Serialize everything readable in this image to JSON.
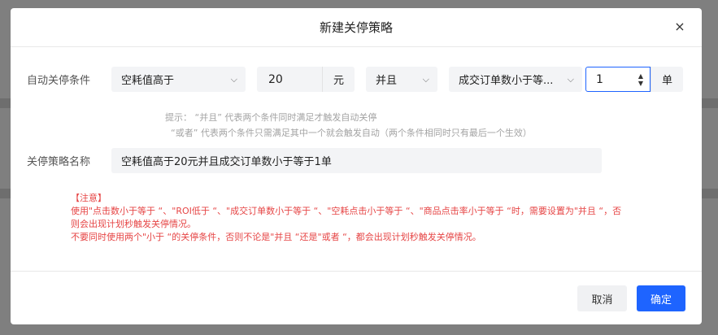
{
  "dialog": {
    "title": "新建关停策略",
    "close_glyph": "×"
  },
  "condition": {
    "label": "自动关停条件",
    "metric1": "空耗值高于",
    "value1": "20",
    "unit1": "元",
    "logic": "并且",
    "metric2": "成交订单数小于等...",
    "value2": "1",
    "unit2": "单",
    "chevron": "⌵"
  },
  "hints": {
    "line1": "提示：  “并且” 代表两个条件同时满足才触发自动关停",
    "line2": "“或者” 代表两个条件只需满足其中一个就会触发自动（两个条件相同时只有最后一个生效）"
  },
  "name": {
    "label": "关停策略名称",
    "value": "空耗值高于20元并且成交订单数小于等于1单"
  },
  "notice": {
    "title": "【注意】",
    "line1": "使用\"点击数小于等于 “、\"ROI低于 “、\"成交订单数小于等于 “、\"空耗点击小于等于 “、\"商品点击率小于等于 “时，需要设置为\"并且 “，否",
    "line2": "则会出现计划秒触发关停情况。",
    "line3": "不要同时使用两个\"小于 “的关停条件，否则不论是\"并且 “还是\"或者 “，都会出现计划秒触发关停情况。"
  },
  "footer": {
    "cancel_label": "取消",
    "ok_label": "确定"
  },
  "colors": {
    "primary": "#1e64ff",
    "warning": "#e64545"
  }
}
